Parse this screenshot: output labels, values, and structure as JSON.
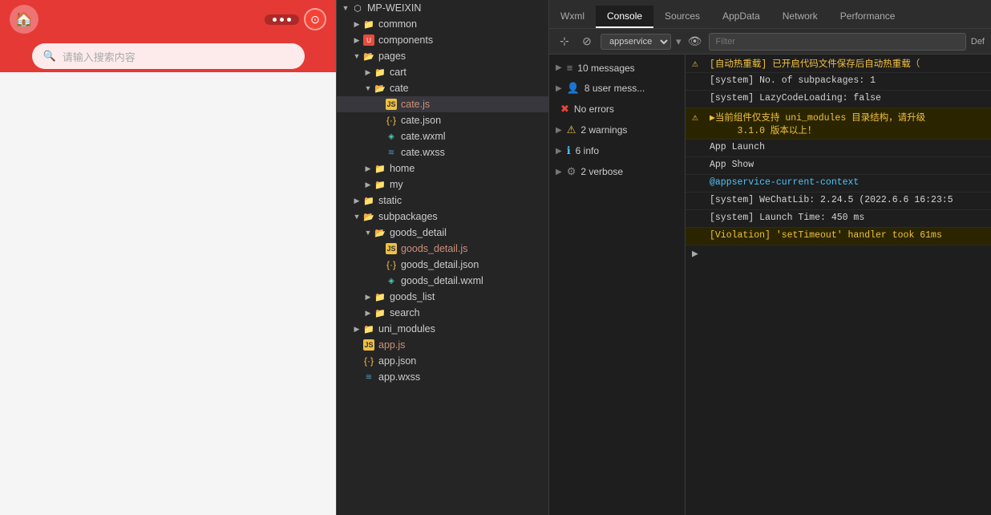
{
  "leftPanel": {
    "searchPlaceholder": "请输入搜索内容"
  },
  "fileTree": {
    "rootLabel": "MP-WEIXIN",
    "items": [
      {
        "id": "common",
        "label": "common",
        "type": "folder",
        "depth": 1,
        "collapsed": true,
        "arrow": "▶"
      },
      {
        "id": "components",
        "label": "components",
        "type": "folder-special",
        "depth": 1,
        "collapsed": true,
        "arrow": "▶"
      },
      {
        "id": "pages",
        "label": "pages",
        "type": "folder",
        "depth": 1,
        "collapsed": false,
        "arrow": "▼"
      },
      {
        "id": "cart",
        "label": "cart",
        "type": "folder",
        "depth": 2,
        "collapsed": true,
        "arrow": "▶"
      },
      {
        "id": "cate",
        "label": "cate",
        "type": "folder",
        "depth": 2,
        "collapsed": false,
        "arrow": "▼"
      },
      {
        "id": "cate.js",
        "label": "cate.js",
        "type": "js",
        "depth": 3,
        "selected": true
      },
      {
        "id": "cate.json",
        "label": "cate.json",
        "type": "json",
        "depth": 3
      },
      {
        "id": "cate.wxml",
        "label": "cate.wxml",
        "type": "wxml",
        "depth": 3
      },
      {
        "id": "cate.wxss",
        "label": "cate.wxss",
        "type": "wxss",
        "depth": 3
      },
      {
        "id": "home",
        "label": "home",
        "type": "folder",
        "depth": 2,
        "collapsed": true,
        "arrow": "▶"
      },
      {
        "id": "my",
        "label": "my",
        "type": "folder",
        "depth": 2,
        "collapsed": true,
        "arrow": "▶"
      },
      {
        "id": "static",
        "label": "static",
        "type": "folder",
        "depth": 1,
        "collapsed": true,
        "arrow": "▶"
      },
      {
        "id": "subpackages",
        "label": "subpackages",
        "type": "folder",
        "depth": 1,
        "collapsed": false,
        "arrow": "▼"
      },
      {
        "id": "goods_detail",
        "label": "goods_detail",
        "type": "folder",
        "depth": 2,
        "collapsed": false,
        "arrow": "▼"
      },
      {
        "id": "goods_detail.js",
        "label": "goods_detail.js",
        "type": "js",
        "depth": 3
      },
      {
        "id": "goods_detail.json",
        "label": "goods_detail.json",
        "type": "json",
        "depth": 3
      },
      {
        "id": "goods_detail.wxml",
        "label": "goods_detail.wxml",
        "type": "wxml",
        "depth": 3
      },
      {
        "id": "goods_list",
        "label": "goods_list",
        "type": "folder",
        "depth": 2,
        "collapsed": true,
        "arrow": "▶"
      },
      {
        "id": "search",
        "label": "search",
        "type": "folder",
        "depth": 2,
        "collapsed": true,
        "arrow": "▶"
      },
      {
        "id": "uni_modules",
        "label": "uni_modules",
        "type": "folder",
        "depth": 1,
        "collapsed": true,
        "arrow": "▶"
      },
      {
        "id": "app.js",
        "label": "app.js",
        "type": "js",
        "depth": 1
      },
      {
        "id": "app.json",
        "label": "app.json",
        "type": "json",
        "depth": 1
      },
      {
        "id": "app.wxss",
        "label": "app.wxss",
        "type": "wxss",
        "depth": 1,
        "partial": true
      }
    ]
  },
  "devtools": {
    "tabs": [
      {
        "id": "wxml",
        "label": "Wxml",
        "active": false
      },
      {
        "id": "console",
        "label": "Console",
        "active": true
      },
      {
        "id": "sources",
        "label": "Sources",
        "active": false
      },
      {
        "id": "appdata",
        "label": "AppData",
        "active": false
      },
      {
        "id": "network",
        "label": "Network",
        "active": false
      },
      {
        "id": "performance",
        "label": "Performance",
        "active": false
      }
    ],
    "toolbar": {
      "serviceLabel": "appservice",
      "filterPlaceholder": "Filter",
      "defLabel": "Def"
    },
    "messages": [
      {
        "id": "all",
        "icon": "≡",
        "iconType": "all",
        "label": "10 messages",
        "arrow": "▶"
      },
      {
        "id": "user",
        "icon": "👤",
        "iconType": "user",
        "label": "8 user mess...",
        "arrow": "▶"
      },
      {
        "id": "errors",
        "icon": "✖",
        "iconType": "error",
        "label": "No errors",
        "arrow": ""
      },
      {
        "id": "warnings",
        "icon": "⚠",
        "iconType": "warning",
        "label": "2 warnings",
        "arrow": "▶"
      },
      {
        "id": "info",
        "icon": "ℹ",
        "iconType": "info",
        "label": "6 info",
        "arrow": "▶"
      },
      {
        "id": "verbose",
        "icon": "⚙",
        "iconType": "verbose",
        "label": "2 verbose",
        "arrow": "▶"
      }
    ],
    "logs": [
      {
        "id": "log1",
        "icon": "⚠",
        "iconType": "warning",
        "text": "[自动热重载] 已开启代码文件保存后自动热重载（",
        "type": "warning"
      },
      {
        "id": "log2",
        "icon": "",
        "iconType": "",
        "text": "[system] No. of subpackages: 1",
        "type": "info"
      },
      {
        "id": "log3",
        "icon": "",
        "iconType": "",
        "text": "[system] LazyCodeLoading: false",
        "type": "info"
      },
      {
        "id": "log4",
        "icon": "⚠",
        "iconType": "warning",
        "text": "▶当前组件仅支持 uni_modules 目录结构，请升级 3.1.0 版本以上！",
        "type": "warning"
      },
      {
        "id": "log5",
        "icon": "",
        "iconType": "",
        "text": "App Launch",
        "type": "info"
      },
      {
        "id": "log6",
        "icon": "",
        "iconType": "",
        "text": "App Show",
        "type": "info"
      },
      {
        "id": "log7",
        "icon": "",
        "iconType": "",
        "text": "@appservice-current-context",
        "type": "link"
      },
      {
        "id": "log8",
        "icon": "",
        "iconType": "",
        "text": "[system] WeChatLib: 2.24.5 (2022.6.6 16:23:5",
        "type": "info"
      },
      {
        "id": "log9",
        "icon": "",
        "iconType": "",
        "text": "[system] Launch Time: 450 ms",
        "type": "info"
      },
      {
        "id": "log10",
        "icon": "",
        "iconType": "violation",
        "text": "[Violation] 'setTimeout' handler took 61ms",
        "type": "violation"
      }
    ]
  }
}
